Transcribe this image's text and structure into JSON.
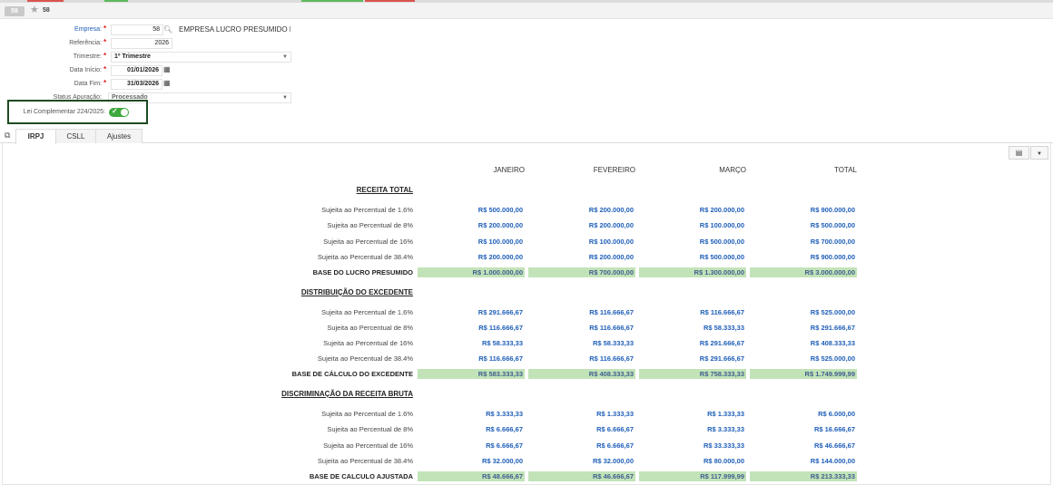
{
  "header": {
    "record_badge": "58",
    "record_number": "58"
  },
  "form": {
    "empresa": {
      "label": "Empresa:",
      "code": "58",
      "name": "EMPRESA LUCRO PRESUMIDO I"
    },
    "referencia": {
      "label": "Referência:",
      "value": "2026"
    },
    "trimestre": {
      "label": "Trimestre:",
      "value": "1º Trimestre"
    },
    "data_inicio": {
      "label": "Data Início:",
      "value": "01/01/2026"
    },
    "data_fim": {
      "label": "Data Fim:",
      "value": "31/03/2026"
    },
    "status": {
      "label": "Status Apuração:",
      "value": "Processado"
    },
    "lei": {
      "label": "Lei Complementar 224/2025:",
      "enabled": true
    }
  },
  "tabs": [
    "IRPJ",
    "CSLL",
    "Ajustes"
  ],
  "active_tab": "IRPJ",
  "table": {
    "columns": [
      "JANEIRO",
      "FEVEREIRO",
      "MARÇO",
      "TOTAL"
    ],
    "sections": [
      {
        "title": "RECEITA TOTAL",
        "rows": [
          {
            "label": "Sujeita ao Percentual de 1.6%",
            "values": [
              "R$ 500.000,00",
              "R$ 200.000,00",
              "R$ 200.000,00",
              "R$ 900.000,00"
            ]
          },
          {
            "label": "Sujeita ao Percentual de 8%",
            "values": [
              "R$ 200.000,00",
              "R$ 200.000,00",
              "R$ 100.000,00",
              "R$ 500.000,00"
            ]
          },
          {
            "label": "Sujeita ao Percentual de 16%",
            "values": [
              "R$ 100.000,00",
              "R$ 100.000,00",
              "R$ 500.000,00",
              "R$ 700.000,00"
            ]
          },
          {
            "label": "Sujeita ao Percentual de 38.4%",
            "values": [
              "R$ 200.000,00",
              "R$ 200.000,00",
              "R$ 500.000,00",
              "R$ 900.000,00"
            ]
          }
        ],
        "total": {
          "label": "BASE DO LUCRO PRESUMIDO",
          "values": [
            "R$ 1.000.000,00",
            "R$ 700.000,00",
            "R$ 1.300.000,00",
            "R$ 3.000.000,00"
          ]
        }
      },
      {
        "title": "DISTRIBUIÇÃO DO EXCEDENTE",
        "rows": [
          {
            "label": "Sujeita ao Percentual de 1.6%",
            "values": [
              "R$ 291.666,67",
              "R$ 116.666,67",
              "R$ 116.666,67",
              "R$ 525.000,00"
            ]
          },
          {
            "label": "Sujeita ao Percentual de 8%",
            "values": [
              "R$ 116.666,67",
              "R$ 116.666,67",
              "R$ 58.333,33",
              "R$ 291.666,67"
            ]
          },
          {
            "label": "Sujeita ao Percentual de 16%",
            "values": [
              "R$ 58.333,33",
              "R$ 58.333,33",
              "R$ 291.666,67",
              "R$ 408.333,33"
            ]
          },
          {
            "label": "Sujeita ao Percentual de 38.4%",
            "values": [
              "R$ 116.666,67",
              "R$ 116.666,67",
              "R$ 291.666,67",
              "R$ 525.000,00"
            ]
          }
        ],
        "total": {
          "label": "BASE DE CÁLCULO DO EXCEDENTE",
          "values": [
            "R$ 583.333,33",
            "R$ 408.333,33",
            "R$ 758.333,33",
            "R$ 1.749.999,99"
          ]
        }
      },
      {
        "title": "DISCRIMINAÇÃO DA RECEITA BRUTA",
        "rows": [
          {
            "label": "Sujeita ao Percentual de 1.6%",
            "values": [
              "R$ 3.333,33",
              "R$ 1.333,33",
              "R$ 1.333,33",
              "R$ 6.000,00"
            ]
          },
          {
            "label": "Sujeita ao Percentual de 8%",
            "values": [
              "R$ 6.666,67",
              "R$ 6.666,67",
              "R$ 3.333,33",
              "R$ 16.666,67"
            ]
          },
          {
            "label": "Sujeita ao Percentual de 16%",
            "values": [
              "R$ 6.666,67",
              "R$ 6.666,67",
              "R$ 33.333,33",
              "R$ 46.666,67"
            ]
          },
          {
            "label": "Sujeita ao Percentual de 38.4%",
            "values": [
              "R$ 32.000,00",
              "R$ 32.000,00",
              "R$ 80.000,00",
              "R$ 144.000,00"
            ]
          }
        ],
        "total": {
          "label": "BASE DE CALCULO AJUSTADA",
          "values": [
            "R$ 48.666,67",
            "R$ 46.666,67",
            "R$ 117.999,99",
            "R$ 213.333,33"
          ]
        }
      }
    ]
  },
  "colors": {
    "accent_blue": "#1f5fb8",
    "total_bg": "#c2e3b8",
    "toggle_on": "#3ea93e",
    "highlight_border": "#1d4b22"
  }
}
